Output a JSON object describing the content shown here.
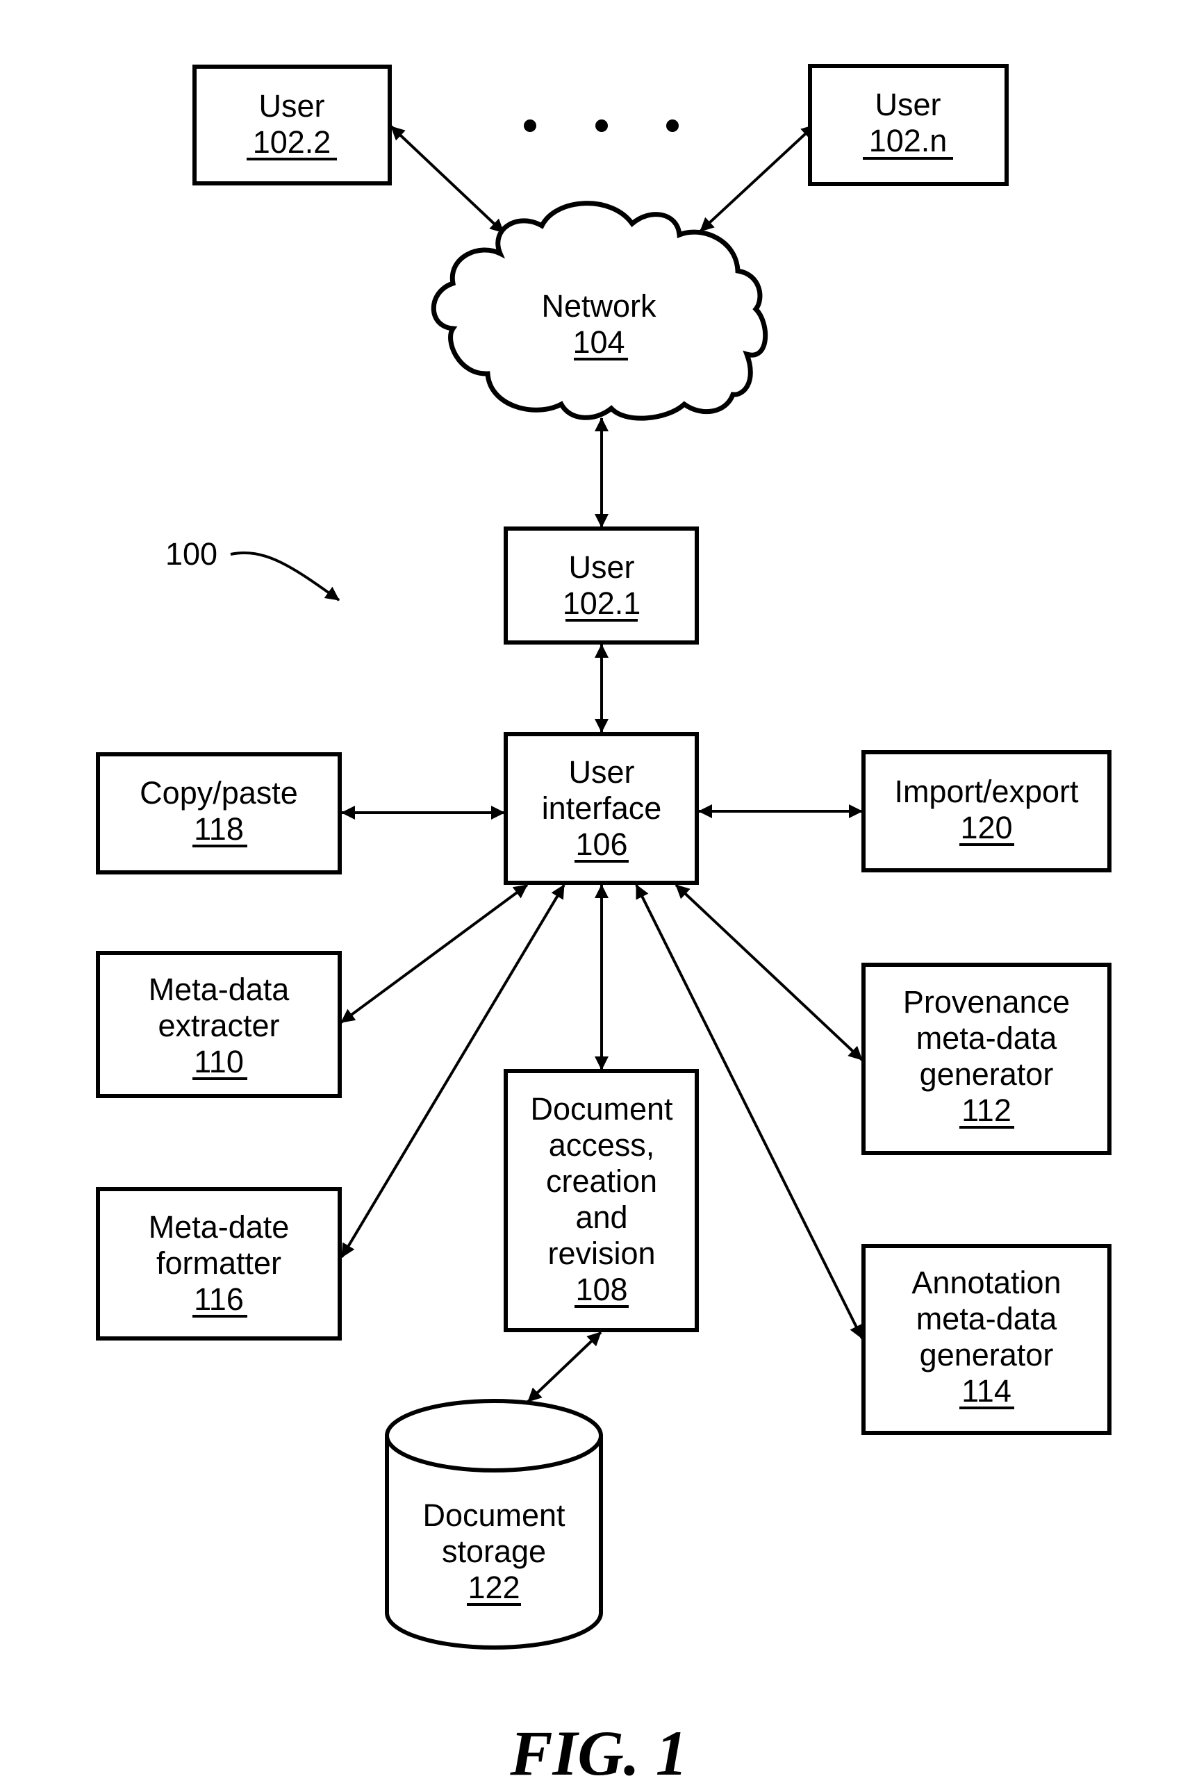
{
  "figure": {
    "label": "FIG. 1",
    "system_ref": "100"
  },
  "nodes": {
    "user_2": {
      "lines": [
        "User"
      ],
      "ref": "102.2"
    },
    "user_n": {
      "lines": [
        "User"
      ],
      "ref": "102.n"
    },
    "ellipsis": "...",
    "network": {
      "lines": [
        "Network"
      ],
      "ref": "104"
    },
    "user_1": {
      "lines": [
        "User"
      ],
      "ref": "102.1"
    },
    "user_interface": {
      "lines": [
        "User",
        "interface"
      ],
      "ref": "106"
    },
    "copy_paste": {
      "lines": [
        "Copy/paste"
      ],
      "ref": "118"
    },
    "import_export": {
      "lines": [
        "Import/export"
      ],
      "ref": "120"
    },
    "metadata_extracter": {
      "lines": [
        "Meta-data",
        "extracter"
      ],
      "ref": "110"
    },
    "provenance": {
      "lines": [
        "Provenance",
        "meta-data",
        "generator"
      ],
      "ref": "112"
    },
    "doc_access": {
      "lines": [
        "Document",
        "access,",
        "creation",
        "and",
        "revision"
      ],
      "ref": "108"
    },
    "metadate_formatter": {
      "lines": [
        "Meta-date",
        "formatter"
      ],
      "ref": "116"
    },
    "annotation": {
      "lines": [
        "Annotation",
        "meta-data",
        "generator"
      ],
      "ref": "114"
    },
    "doc_storage": {
      "lines": [
        "Document",
        "storage"
      ],
      "ref": "122"
    }
  },
  "edges": [
    {
      "from": "user_2",
      "to": "network",
      "bidirectional": true
    },
    {
      "from": "user_n",
      "to": "network",
      "bidirectional": true
    },
    {
      "from": "network",
      "to": "user_1",
      "bidirectional": true
    },
    {
      "from": "user_1",
      "to": "user_interface",
      "bidirectional": true
    },
    {
      "from": "copy_paste",
      "to": "user_interface",
      "bidirectional": true
    },
    {
      "from": "user_interface",
      "to": "import_export",
      "bidirectional": true
    },
    {
      "from": "user_interface",
      "to": "metadata_extracter",
      "bidirectional": true
    },
    {
      "from": "user_interface",
      "to": "metadate_formatter",
      "bidirectional": true
    },
    {
      "from": "user_interface",
      "to": "doc_access",
      "bidirectional": true
    },
    {
      "from": "user_interface",
      "to": "annotation",
      "bidirectional": true
    },
    {
      "from": "user_interface",
      "to": "provenance",
      "bidirectional": true
    },
    {
      "from": "doc_access",
      "to": "doc_storage",
      "bidirectional": true
    }
  ]
}
